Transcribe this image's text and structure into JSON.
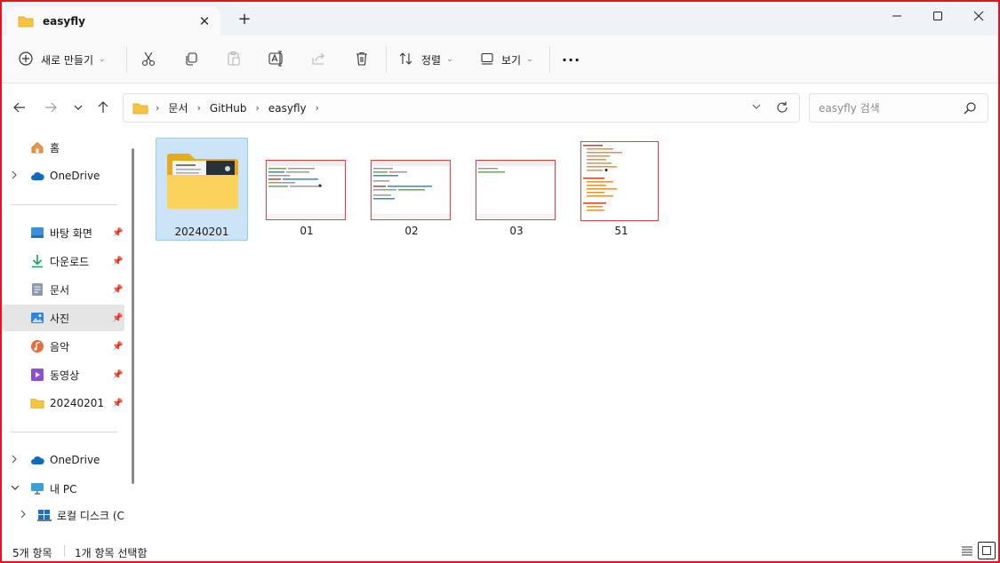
{
  "window": {
    "tab_title": "easyfly",
    "tab_close_glyph": "✕",
    "new_tab_glyph": "+",
    "controls": [
      "minimize-icon",
      "maximize-icon",
      "close-icon"
    ]
  },
  "toolbar": {
    "new_label": "새로 만들기",
    "sort_label": "정렬",
    "view_label": "보기",
    "more_label": "···",
    "caret": "⌄",
    "icons": [
      "plus-circle-icon",
      "cut-icon",
      "copy-icon",
      "paste-icon",
      "rename-icon",
      "share-icon",
      "delete-icon",
      "sort-icon",
      "view-icon",
      "more-icon"
    ]
  },
  "address": {
    "crumbs": [
      "문서",
      "GitHub",
      "easyfly"
    ],
    "separator": "›",
    "search_placeholder": "easyfly 검색"
  },
  "sidebar": {
    "home": "홈",
    "onedrive": "OneDrive",
    "quick": [
      {
        "label": "바탕 화면",
        "icon": "desktop-icon"
      },
      {
        "label": "다운로드",
        "icon": "download-icon"
      },
      {
        "label": "문서",
        "icon": "documents-icon"
      },
      {
        "label": "사진",
        "icon": "pictures-icon"
      },
      {
        "label": "음악",
        "icon": "music-icon"
      },
      {
        "label": "동영상",
        "icon": "videos-icon"
      },
      {
        "label": "20240201",
        "icon": "folder-icon"
      }
    ],
    "onedrive2": "OneDrive",
    "this_pc": "내 PC",
    "local_disk": "로컬 디스크 (C"
  },
  "files": [
    {
      "name": "20240201",
      "type": "folder"
    },
    {
      "name": "01",
      "type": "image"
    },
    {
      "name": "02",
      "type": "image"
    },
    {
      "name": "03",
      "type": "image"
    },
    {
      "name": "51",
      "type": "image"
    }
  ],
  "status": {
    "count": "5개 항목",
    "selected": "1개 항목 선택함"
  },
  "colors": {
    "accent": "#0067c0",
    "selection": "#cce4f7",
    "folder": "#f8c542",
    "frame": "#e81123"
  }
}
